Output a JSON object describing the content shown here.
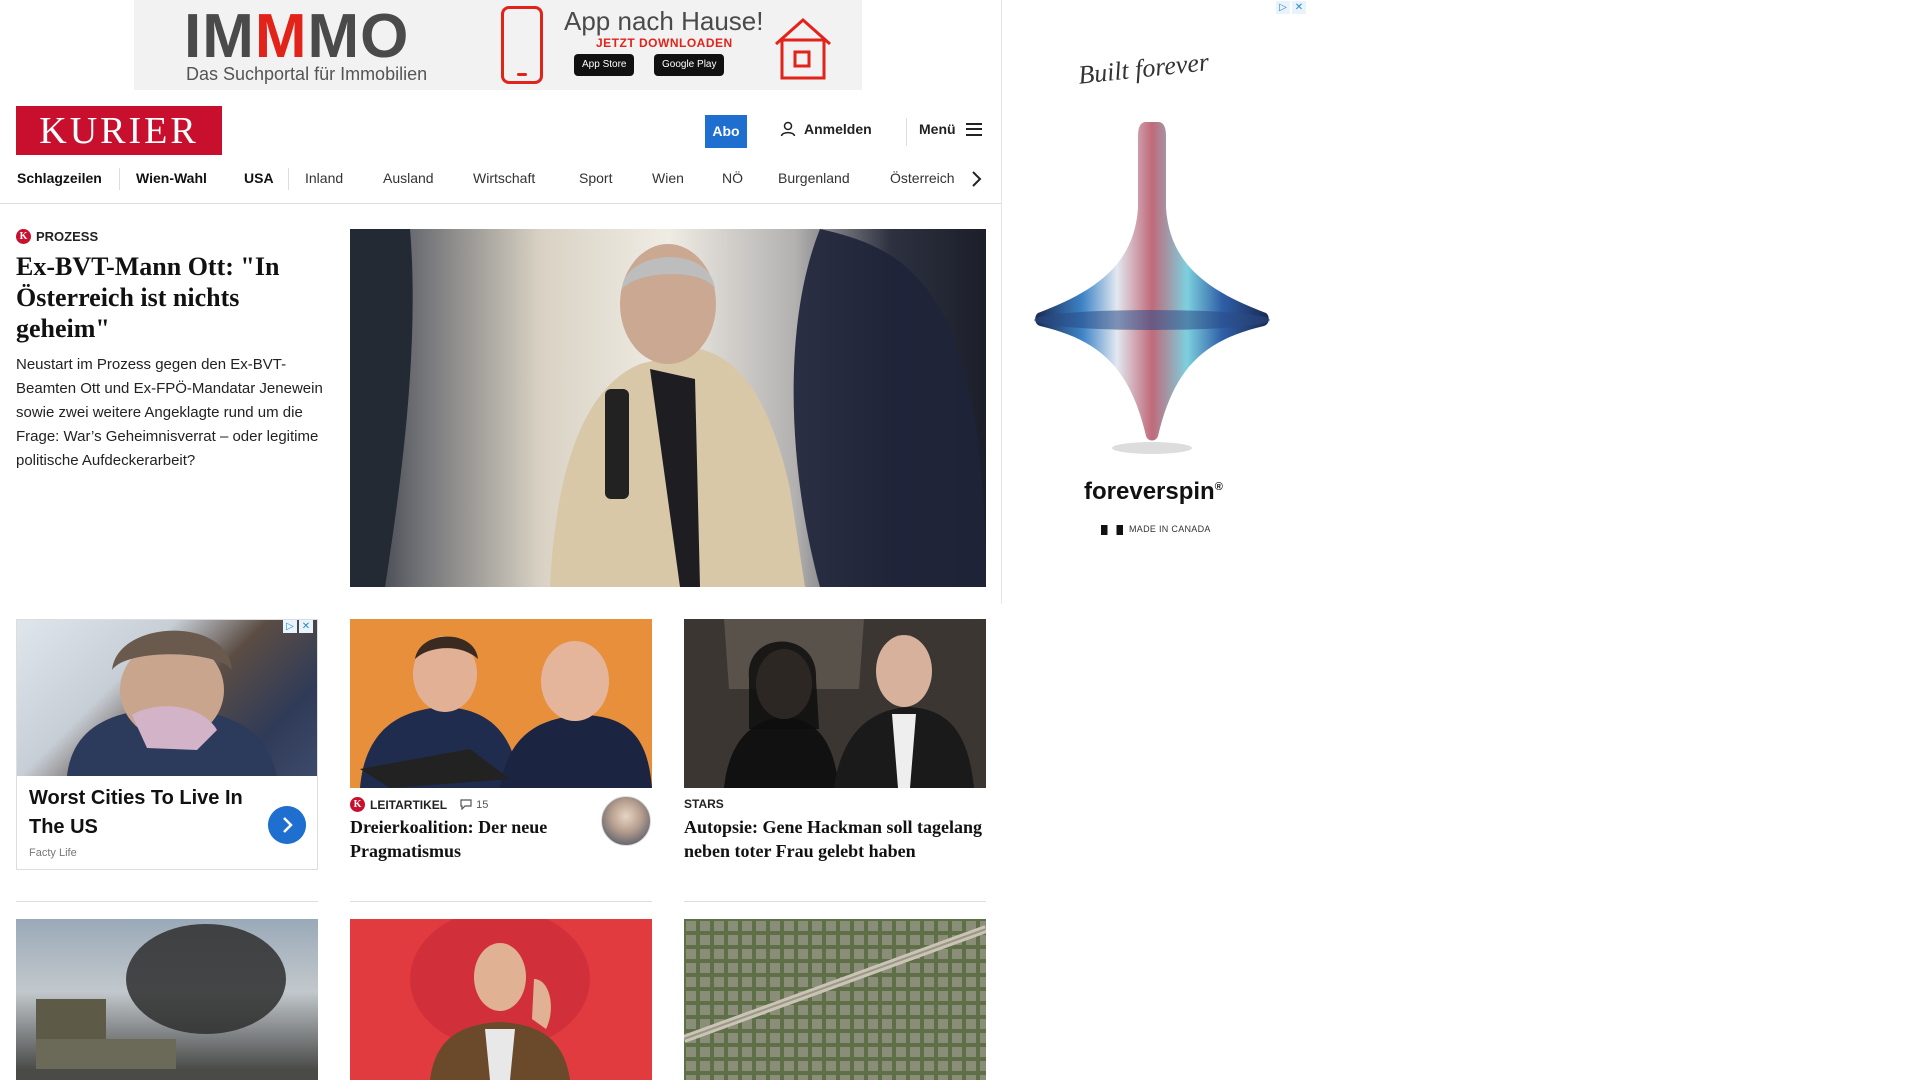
{
  "top_ad": {
    "brand_prefix": "IM",
    "brand_accent": "M",
    "brand_suffix": "MO",
    "tagline": "Das Suchportal für Immobilien",
    "headline": "App nach Hause!",
    "cta": "JETZT DOWNLOADEN",
    "store_apple": "App Store",
    "store_google": "Google Play"
  },
  "header": {
    "logo": "KURIER",
    "abo": "Abo",
    "login": "Anmelden",
    "menu": "Menü"
  },
  "nav": {
    "items": [
      "Schlagzeilen",
      "Wien-Wahl",
      "USA",
      "Inland",
      "Ausland",
      "Wirtschaft",
      "Sport",
      "Wien",
      "NÖ",
      "Burgenland",
      "Österreich"
    ]
  },
  "side_ad": {
    "signature": "Built forever",
    "brand": "foreverspin",
    "registered": "®",
    "made_in": "MADE IN CANADA"
  },
  "lead": {
    "kicker": "PROZESS",
    "title": "Ex-BVT-Mann Ott: \"In Österreich ist nichts geheim\"",
    "text": "Neustart im Prozess gegen den Ex-BVT-Beamten Ott und Ex-FPÖ-Mandatar Jenewein sowie zwei weitere Angeklagte rund um die Frage: War’s Geheimnisverrat – oder legitime politische Aufdeckerarbeit?"
  },
  "cards": {
    "ad": {
      "title": "Worst Cities To Live In The US",
      "source": "Facty Life"
    },
    "leitartikel": {
      "kicker": "LEITARTIKEL",
      "comments": "15",
      "title": "Dreierkoalition: Der neue Pragmatismus"
    },
    "stars": {
      "kicker": "STARS",
      "title": "Autopsie: Gene Hackman soll tagelang neben toter Frau gelebt haben"
    }
  },
  "colors": {
    "brand_red": "#c8102e",
    "accent_blue": "#1f6fd1",
    "ad_red": "#e2231a"
  },
  "icons": {
    "user": "user-icon",
    "menu": "hamburger-icon",
    "next": "chevron-right-icon",
    "comment": "comment-icon",
    "adchoices": "adchoices-icon",
    "close": "close-icon"
  }
}
